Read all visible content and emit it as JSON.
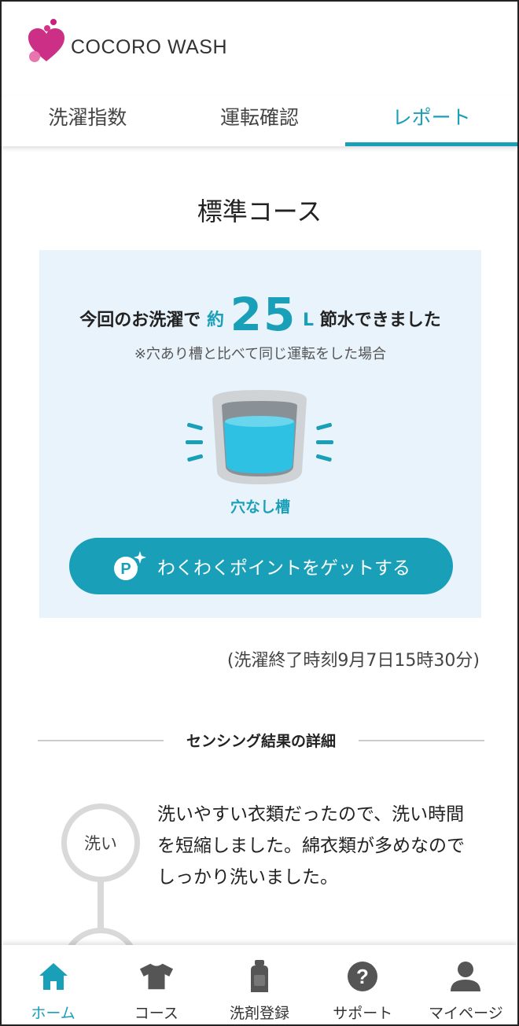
{
  "header": {
    "brand": "COCORO WASH"
  },
  "tabs": [
    {
      "label": "洗濯指数",
      "active": false
    },
    {
      "label": "運転確認",
      "active": false
    },
    {
      "label": "レポート",
      "active": true
    }
  ],
  "report": {
    "course_title": "標準コース",
    "save_prefix": "今回のお洗濯で",
    "save_approx": "約",
    "save_value": "25",
    "save_unit": "L",
    "save_suffix": "節水できました",
    "note": "※穴あり槽と比べて同じ運転をした場合",
    "tub_label": "穴なし槽",
    "points_button": "わくわくポイントをゲットする",
    "finish_time": "(洗濯終了時刻9月7日15時30分)"
  },
  "sensing": {
    "heading": "センシング結果の詳細",
    "steps": [
      {
        "label": "洗い",
        "text": "洗いやすい衣類だったので、洗い時間を短縮しました。綿衣類が多めなのでしっかり洗いました。"
      }
    ]
  },
  "bottom_nav": [
    {
      "label": "ホーム",
      "icon": "home-icon",
      "active": true
    },
    {
      "label": "コース",
      "icon": "tshirt-icon",
      "active": false
    },
    {
      "label": "洗剤登録",
      "icon": "detergent-bottle-icon",
      "active": false
    },
    {
      "label": "サポート",
      "icon": "help-icon",
      "active": false
    },
    {
      "label": "マイページ",
      "icon": "user-icon",
      "active": false
    }
  ],
  "colors": {
    "accent": "#1a9fb8",
    "card_bg": "#e9f3fc",
    "logo_pink": "#d6338a"
  }
}
